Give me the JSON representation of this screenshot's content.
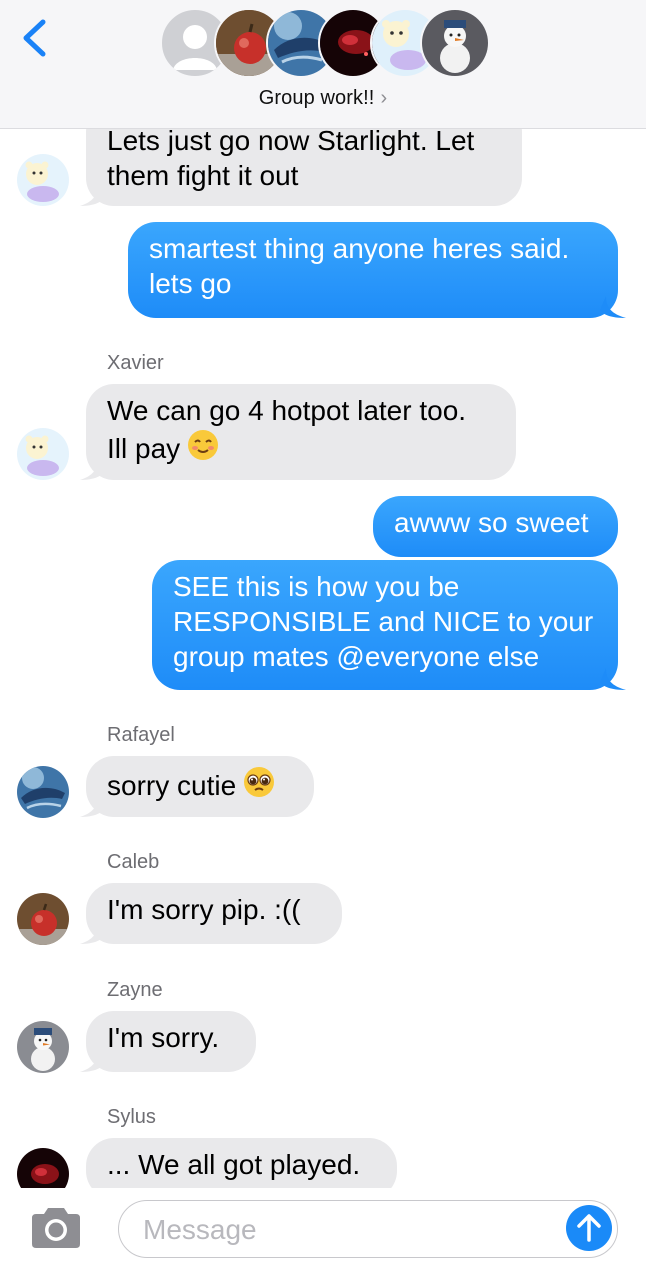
{
  "header": {
    "group_name": "Group work!!",
    "chevron": "›",
    "back_icon": "chevron-left-icon",
    "accent_color": "#1a82f7"
  },
  "messages": [
    {
      "direction": "incoming",
      "lines": [
        "Lets just go now Starlight. Let",
        "them fight it out"
      ],
      "avatar": "polar-bear-avatar"
    },
    {
      "direction": "outgoing",
      "lines": [
        "smartest thing anyone heres said.",
        "lets go"
      ]
    },
    {
      "direction": "incoming",
      "sender": "Xavier",
      "lines": [
        "We can go 4 hotpot later too.",
        "Ill pay"
      ],
      "emoji": "smiling-face-icon",
      "avatar": "polar-bear-avatar"
    },
    {
      "direction": "outgoing",
      "lines": [
        "awww so sweet"
      ]
    },
    {
      "direction": "outgoing",
      "lines": [
        "SEE this is how you be",
        "RESPONSIBLE and NICE to your",
        "group mates @everyone else"
      ]
    },
    {
      "direction": "incoming",
      "sender": "Rafayel",
      "lines": [
        "sorry cutie"
      ],
      "emoji": "pleading-face-icon",
      "avatar": "whale-avatar"
    },
    {
      "direction": "incoming",
      "sender": "Caleb",
      "lines": [
        "I'm sorry pip. :(("
      ],
      "avatar": "apple-avatar"
    },
    {
      "direction": "incoming",
      "sender": "Zayne",
      "lines": [
        "I'm sorry."
      ],
      "avatar": "snowman-avatar"
    },
    {
      "direction": "incoming",
      "sender": "Sylus",
      "lines": [
        "... We all got played."
      ],
      "avatar": "red-nebula-avatar"
    }
  ],
  "composer": {
    "placeholder": "Message",
    "camera_icon": "camera-icon",
    "send_icon": "arrow-up-icon"
  },
  "colors": {
    "incoming_bubble": "#e9e9eb",
    "outgoing_bubble": "#1e8cf8",
    "sender_label": "#6d6d72"
  }
}
